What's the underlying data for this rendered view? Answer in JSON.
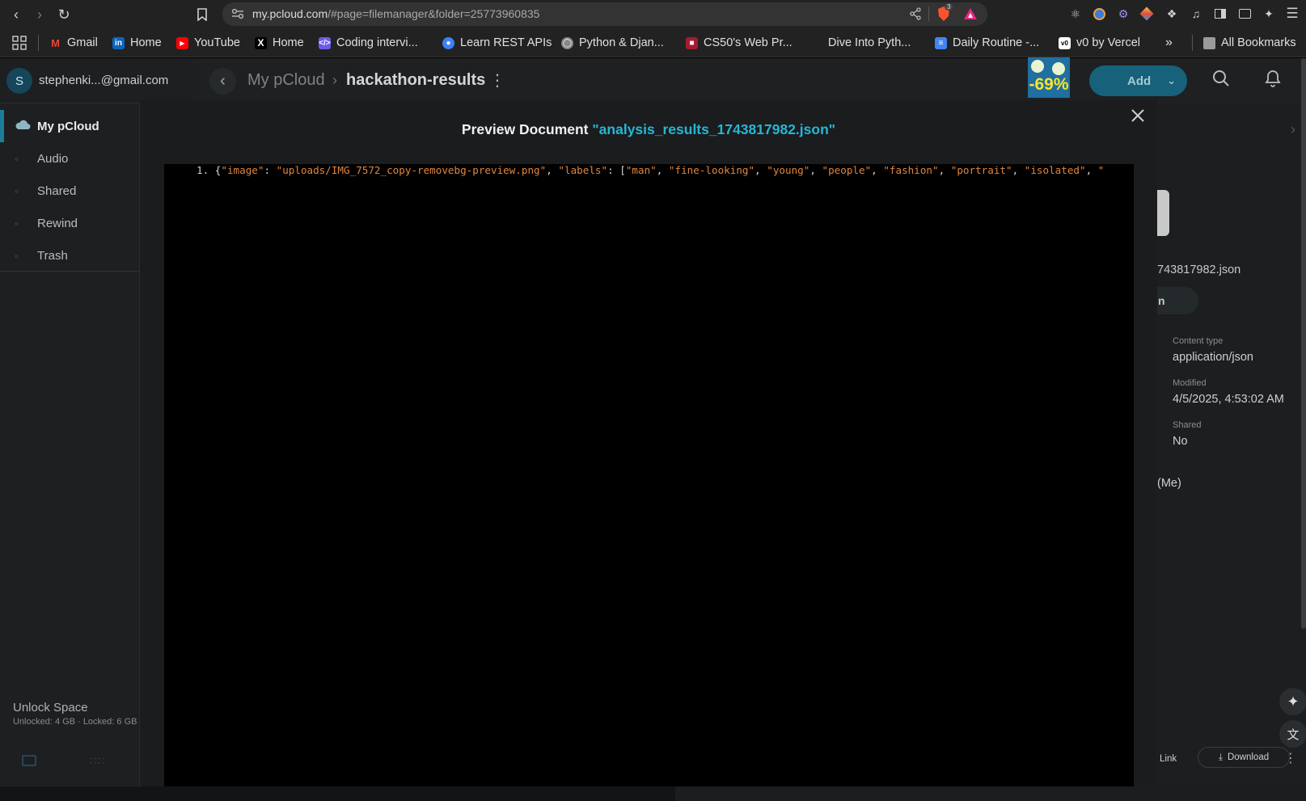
{
  "browser": {
    "url_host": "my.pcloud.com",
    "url_path": "/#page=filemanager&folder=25773960835",
    "shield_count": "3",
    "bookmarks": [
      {
        "label": "Gmail",
        "icon": "gmail-icon",
        "color": "#ea4335"
      },
      {
        "label": "Home",
        "icon": "linkedin-icon",
        "color": "#0a66c2"
      },
      {
        "label": "YouTube",
        "icon": "youtube-icon",
        "color": "#ff0000"
      },
      {
        "label": "Home",
        "icon": "x-icon",
        "color": "#000000"
      },
      {
        "label": "Coding intervi...",
        "icon": "coding-icon",
        "color": "#6c5ce7"
      },
      {
        "label": "Learn REST APIs",
        "icon": "rest-icon",
        "color": "#3b82f6"
      },
      {
        "label": "Python & Djan...",
        "icon": "globe-icon",
        "color": "#888888"
      },
      {
        "label": "CS50's Web Pr...",
        "icon": "cs50-icon",
        "color": "#a51c30"
      },
      {
        "label": "Dive Into Pyth...",
        "icon": "none",
        "color": "#222222"
      },
      {
        "label": "Daily Routine -...",
        "icon": "docs-icon",
        "color": "#4285f4"
      },
      {
        "label": "v0 by Vercel",
        "icon": "v0-icon",
        "color": "#ffffff"
      }
    ],
    "all_bookmarks": "All Bookmarks"
  },
  "account": {
    "initial": "S",
    "email": "stephenki...@gmail.com"
  },
  "header": {
    "breadcrumb_root": "My pCloud",
    "breadcrumb_current": "hackathon-results",
    "promo_badge": "-69%",
    "add_label": "Add"
  },
  "sidebar": {
    "items": [
      {
        "label": "My pCloud"
      },
      {
        "label": "Audio"
      },
      {
        "label": "Shared"
      },
      {
        "label": "Rewind"
      },
      {
        "label": "Trash"
      }
    ],
    "unlock_title": "Unlock Space",
    "unlock_detail": "Unlocked: 4 GB · Locked: 6 GB"
  },
  "info_panel": {
    "filename_partial": "743817982.json",
    "button_partial": "n",
    "content_type_label": "Content type",
    "content_type_value": "application/json",
    "modified_label": "Modified",
    "modified_value": "4/5/2025, 4:53:02 AM",
    "shared_label": "Shared",
    "shared_value": "No",
    "owner_partial": "(Me)",
    "link_label": "Link",
    "download_label": "Download"
  },
  "modal": {
    "title_prefix": "Preview Document",
    "file_name": "\"analysis_results_1743817982.json\"",
    "code": {
      "line_number": "1.",
      "prefix": "{",
      "key_image": "\"image\"",
      "value_image": "\"uploads/IMG_7572_copy-removebg-preview.png\"",
      "key_labels": "\"labels\"",
      "labels": [
        "\"man\"",
        "\"fine-looking\"",
        "\"young\"",
        "\"people\"",
        "\"fashion\"",
        "\"portrait\"",
        "\"isolated\"",
        "\""
      ]
    }
  }
}
